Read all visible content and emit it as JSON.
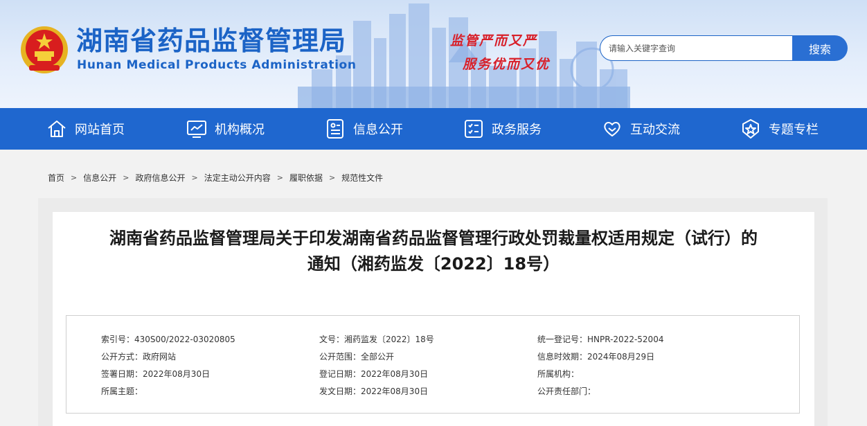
{
  "header": {
    "title": "湖南省药品监督管理局",
    "subtitle": "Hunan Medical Products Administration",
    "slogan_line1": "监管严而又严",
    "slogan_line2": "服务优而又优",
    "search_placeholder": "请输入关键字查询",
    "search_button": "搜索",
    "colors": {
      "brand": "#1b63c6",
      "nav": "#1f67cf",
      "slogan": "#d8202a"
    }
  },
  "nav": {
    "items": [
      {
        "label": "网站首页",
        "icon": "home-icon"
      },
      {
        "label": "机构概况",
        "icon": "chart-screen-icon"
      },
      {
        "label": "信息公开",
        "icon": "document-icon"
      },
      {
        "label": "政务服务",
        "icon": "checklist-icon"
      },
      {
        "label": "互动交流",
        "icon": "heart-hands-icon"
      },
      {
        "label": "专题专栏",
        "icon": "star-badge-icon"
      }
    ]
  },
  "breadcrumb": [
    "首页",
    "信息公开",
    "政府信息公开",
    "法定主动公开内容",
    "履职依据",
    "规范性文件"
  ],
  "article": {
    "title_line1": "湖南省药品监督管理局关于印发湖南省药品监督管理行政处罚裁量权适用规定（试行）的",
    "title_line2": "通知（湘药监发〔2022〕18号）"
  },
  "meta": {
    "col1": [
      "索引号：430S00/2022-03020805",
      "公开方式：政府网站",
      "签署日期：2022年08月30日",
      "所属主题："
    ],
    "col2": [
      "文号：湘药监发〔2022〕18号",
      "公开范围：全部公开",
      "登记日期：2022年08月30日",
      "发文日期：2022年08月30日"
    ],
    "col3": [
      "统一登记号：HNPR-2022-52004",
      "信息时效期：2024年08月29日",
      "所属机构：",
      "公开责任部门："
    ]
  }
}
